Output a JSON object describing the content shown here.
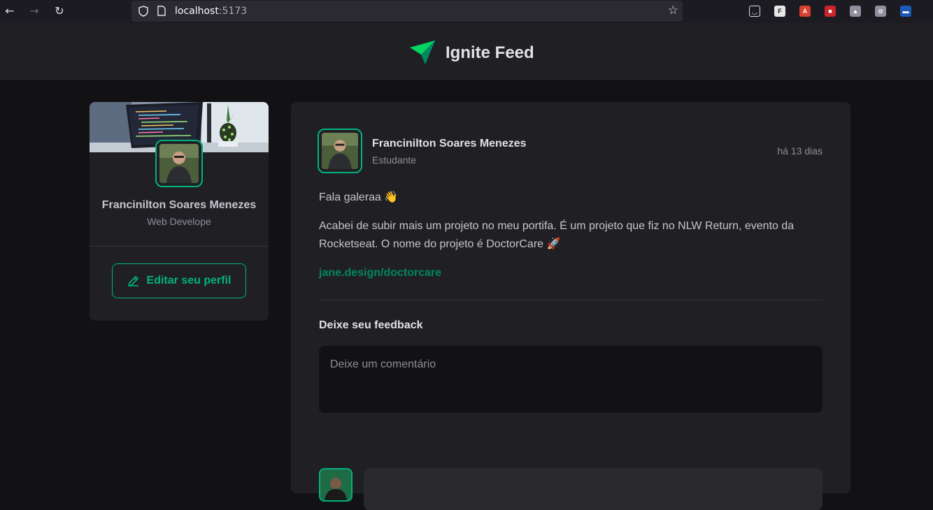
{
  "browser": {
    "url_host": "localhost",
    "url_port": ":5173",
    "extensions": [
      {
        "name": "pocket-icon",
        "color": "#1c1b22",
        "glyph": "◡"
      },
      {
        "name": "f-extension-icon",
        "color": "#e6e6e6",
        "glyph": "F"
      },
      {
        "name": "translate-extension-icon",
        "color": "#d8412f",
        "glyph": "A"
      },
      {
        "name": "red-extension-icon",
        "color": "#c9252c",
        "glyph": "■"
      },
      {
        "name": "shield-extension-icon",
        "color": "#8f8f9d",
        "glyph": "▲"
      },
      {
        "name": "blocker-extension-icon",
        "color": "#8f8f9d",
        "glyph": "⊘"
      },
      {
        "name": "blue-extension-icon",
        "color": "#1e58b8",
        "glyph": "▬"
      }
    ]
  },
  "header": {
    "title": "Ignite Feed"
  },
  "sidebar": {
    "name": "Francinilton Soares Menezes",
    "role": "Web Develope",
    "edit_label": "Editar seu perfil"
  },
  "post": {
    "author_name": "Francinilton Soares Menezes",
    "author_role": "Estudante",
    "time": "há 13 dias",
    "paragraph_1": "Fala galeraa 👋",
    "paragraph_2": "Acabei de subir mais um projeto no meu portifa. É um projeto que fiz no NLW Return, evento da Rocketseat. O nome do projeto é DoctorCare 🚀",
    "link": "jane.design/doctorcare",
    "feedback_title": "Deixe seu feedback",
    "comment_placeholder": "Deixe um comentário"
  },
  "colors": {
    "accent": "#00b37e",
    "link": "#00875f",
    "background": "#121214",
    "card": "#202024"
  }
}
